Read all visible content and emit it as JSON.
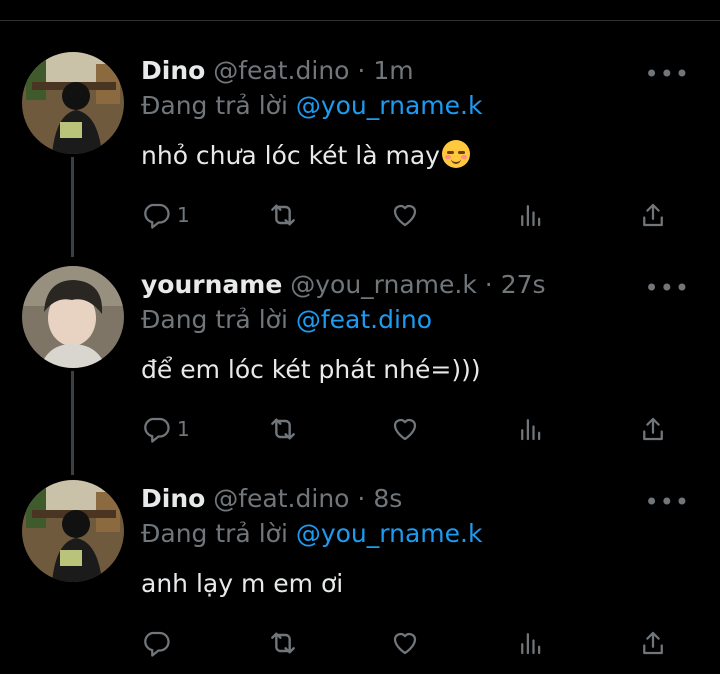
{
  "tweets": [
    {
      "name": "Dino",
      "handle": "@feat.dino",
      "time": "· 1m",
      "reply_prefix": "Đang trả lời",
      "reply_to": "@you_rname.k",
      "text": "nhỏ chưa lóc két là may",
      "emoji_icon": "relieved-face-emoji",
      "reply_count": "1",
      "avatar": "dino-avatar"
    },
    {
      "name": "yourname",
      "handle": "@you_rname.k",
      "time": "· 27s",
      "reply_prefix": "Đang trả lời",
      "reply_to": "@feat.dino",
      "text": "để em lóc két phát nhé=)))",
      "reply_count": "1",
      "avatar": "yourname-avatar"
    },
    {
      "name": "Dino",
      "handle": "@feat.dino",
      "time": "· 8s",
      "reply_prefix": "Đang trả lời",
      "reply_to": "@you_rname.k",
      "text": "anh lạy m em ơi",
      "reply_count": "",
      "avatar": "dino-avatar"
    }
  ],
  "more_label": "•••",
  "icons": [
    "reply-icon",
    "retweet-icon",
    "like-icon",
    "views-icon",
    "share-icon",
    "more-icon"
  ],
  "colors": {
    "background": "#000000",
    "text": "#e7e9ea",
    "muted": "#71767b",
    "link": "#1d9bf0",
    "thread_line": "#3a3f44"
  }
}
